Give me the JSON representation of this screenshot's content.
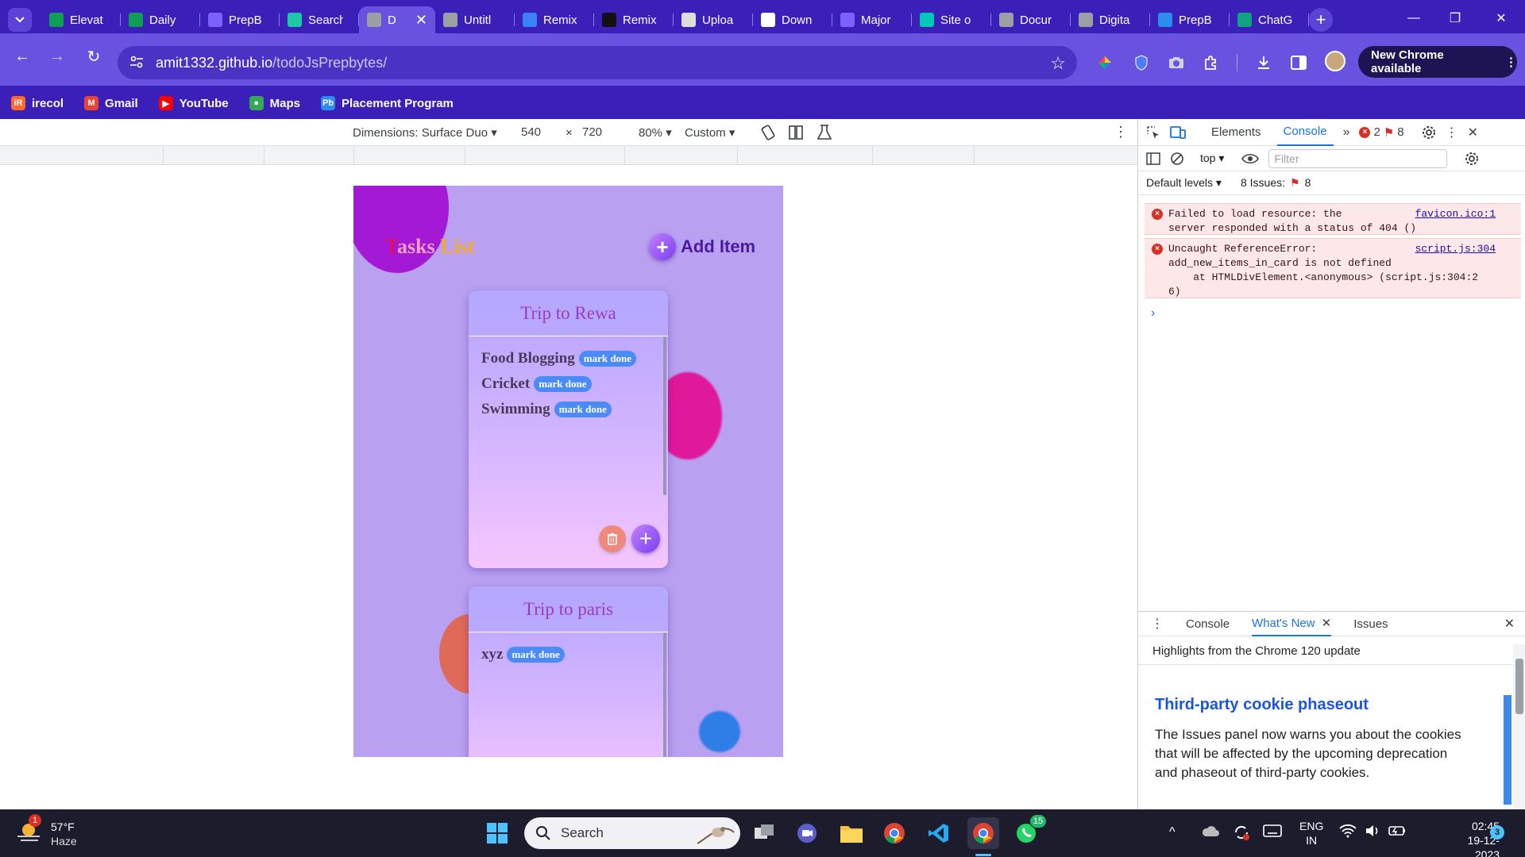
{
  "browser": {
    "tabs": [
      {
        "label": "Elevat",
        "icon": "sheets-icon",
        "color": "#0f9d58"
      },
      {
        "label": "Daily",
        "icon": "sheets-icon",
        "color": "#0f9d58"
      },
      {
        "label": "PrepB",
        "icon": "forms-icon",
        "color": "#7b61ff"
      },
      {
        "label": "Search",
        "icon": "vuetify-icon",
        "color": "#1ec8a5"
      },
      {
        "label": "D",
        "icon": "globe-icon",
        "color": "#9aa0a6",
        "active": true
      },
      {
        "label": "Untitl",
        "icon": "globe-icon",
        "color": "#9aa0a6"
      },
      {
        "label": "Remix",
        "icon": "remix-icon",
        "color": "#3b82f6"
      },
      {
        "label": "Remix",
        "icon": "github-icon",
        "color": "#111111"
      },
      {
        "label": "Uploa",
        "icon": "layers-icon",
        "color": "#dddddd"
      },
      {
        "label": "Down",
        "icon": "download-icon",
        "color": "#ffffff"
      },
      {
        "label": "Major",
        "icon": "forms-icon",
        "color": "#7b61ff"
      },
      {
        "label": "Site o",
        "icon": "diamond-icon",
        "color": "#00c7b7"
      },
      {
        "label": "Docur",
        "icon": "globe-icon",
        "color": "#9aa0a6"
      },
      {
        "label": "Digita",
        "icon": "globe-icon",
        "color": "#9aa0a6"
      },
      {
        "label": "PrepB",
        "icon": "prepbytes-icon",
        "color": "#2d8cf0"
      },
      {
        "label": "ChatG",
        "icon": "chatgpt-icon",
        "color": "#10a37f"
      }
    ],
    "url_host": "amit1332.github.io",
    "url_path": "/todoJsPrepbytes/",
    "new_chrome_label": "New Chrome available",
    "bookmarks": [
      {
        "label": "irecol",
        "icon": "irecol-icon",
        "color": "#ff6a2b",
        "glyph": "iR"
      },
      {
        "label": "Gmail",
        "icon": "gmail-icon",
        "color": "#ea4335",
        "glyph": "M"
      },
      {
        "label": "YouTube",
        "icon": "youtube-icon",
        "color": "#ff0000",
        "glyph": "▶"
      },
      {
        "label": "Maps",
        "icon": "maps-icon",
        "color": "#34a853",
        "glyph": "●"
      },
      {
        "label": "Placement Program",
        "icon": "prepbytes-icon",
        "color": "#2d8cf0",
        "glyph": "Pb"
      }
    ]
  },
  "device_toolbar": {
    "dimensions_label": "Dimensions: Surface Duo",
    "width": "540",
    "times": "×",
    "height": "720",
    "zoom": "80%",
    "throttle": "Custom"
  },
  "app": {
    "title_first": "T",
    "title_rest1": "asks ",
    "title_L": "L",
    "title_rest2": "ist",
    "add_item_label": "Add Item",
    "cards": [
      {
        "title": "Trip to Rewa",
        "items": [
          {
            "text": "Food Blogging",
            "action": "mark done"
          },
          {
            "text": "Cricket",
            "action": "mark done"
          },
          {
            "text": "Swimming",
            "action": "mark done"
          }
        ]
      },
      {
        "title": "Trip to paris",
        "items": [
          {
            "text": "xyz",
            "action": "mark done"
          }
        ]
      }
    ]
  },
  "devtools": {
    "tabs": [
      "Elements",
      "Console"
    ],
    "selected_tab": "Console",
    "error_count": "2",
    "issue_count": "8",
    "context": "top",
    "filter_placeholder": "Filter",
    "levels": "Default levels",
    "issues_label": "8 Issues:",
    "issues_count": "8",
    "messages": [
      {
        "text": "Failed to load resource: the\nserver responded with a status of 404 ()",
        "link": "favicon.ico:1"
      },
      {
        "text": "Uncaught ReferenceError:\nadd_new_items_in_card is not defined\n    at HTMLDivElement.<anonymous> (script.js:304:2\n6)",
        "link": "script.js:304"
      }
    ],
    "prompt": "›",
    "drawer_tabs": [
      "Console",
      "What's New",
      "Issues"
    ],
    "drawer_selected": "What's New",
    "highlights": "Highlights from the Chrome 120 update",
    "article_title": "Third-party cookie phaseout",
    "article_body": "The Issues panel now warns you about the cookies that will be affected by the upcoming deprecation and phaseout of third-party cookies."
  },
  "taskbar": {
    "weather_temp": "57°F",
    "weather_desc": "Haze",
    "weather_badge": "1",
    "search_label": "Search",
    "whatsapp_badge": "15",
    "lang_top": "ENG",
    "lang_bottom": "IN",
    "time": "02:45",
    "date": "19-12-2023",
    "notif_count": "3"
  }
}
